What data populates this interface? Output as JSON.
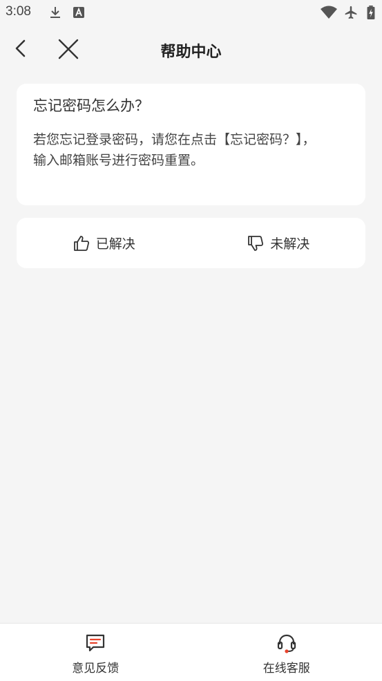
{
  "status_bar": {
    "time": "3:08",
    "icons": [
      "download-icon",
      "text-icon",
      "wifi-icon",
      "airplane-icon",
      "battery-icon"
    ]
  },
  "header": {
    "title": "帮助中心",
    "back_icon": "chevron-left-icon",
    "close_icon": "close-icon"
  },
  "question": {
    "title": "忘记密码怎么办？",
    "answer_line1": "若您忘记登录密码，请您在点击【忘记密码？】，",
    "answer_line2": "输入邮箱账号进行密码重置。"
  },
  "feedback": {
    "resolved_label": "已解决",
    "unresolved_label": "未解决"
  },
  "bottom_bar": {
    "feedback_label": "意见反馈",
    "support_label": "在线客服"
  },
  "colors": {
    "background": "#f5f5f5",
    "card": "#ffffff",
    "accent": "#e8432c",
    "text": "#333333"
  }
}
